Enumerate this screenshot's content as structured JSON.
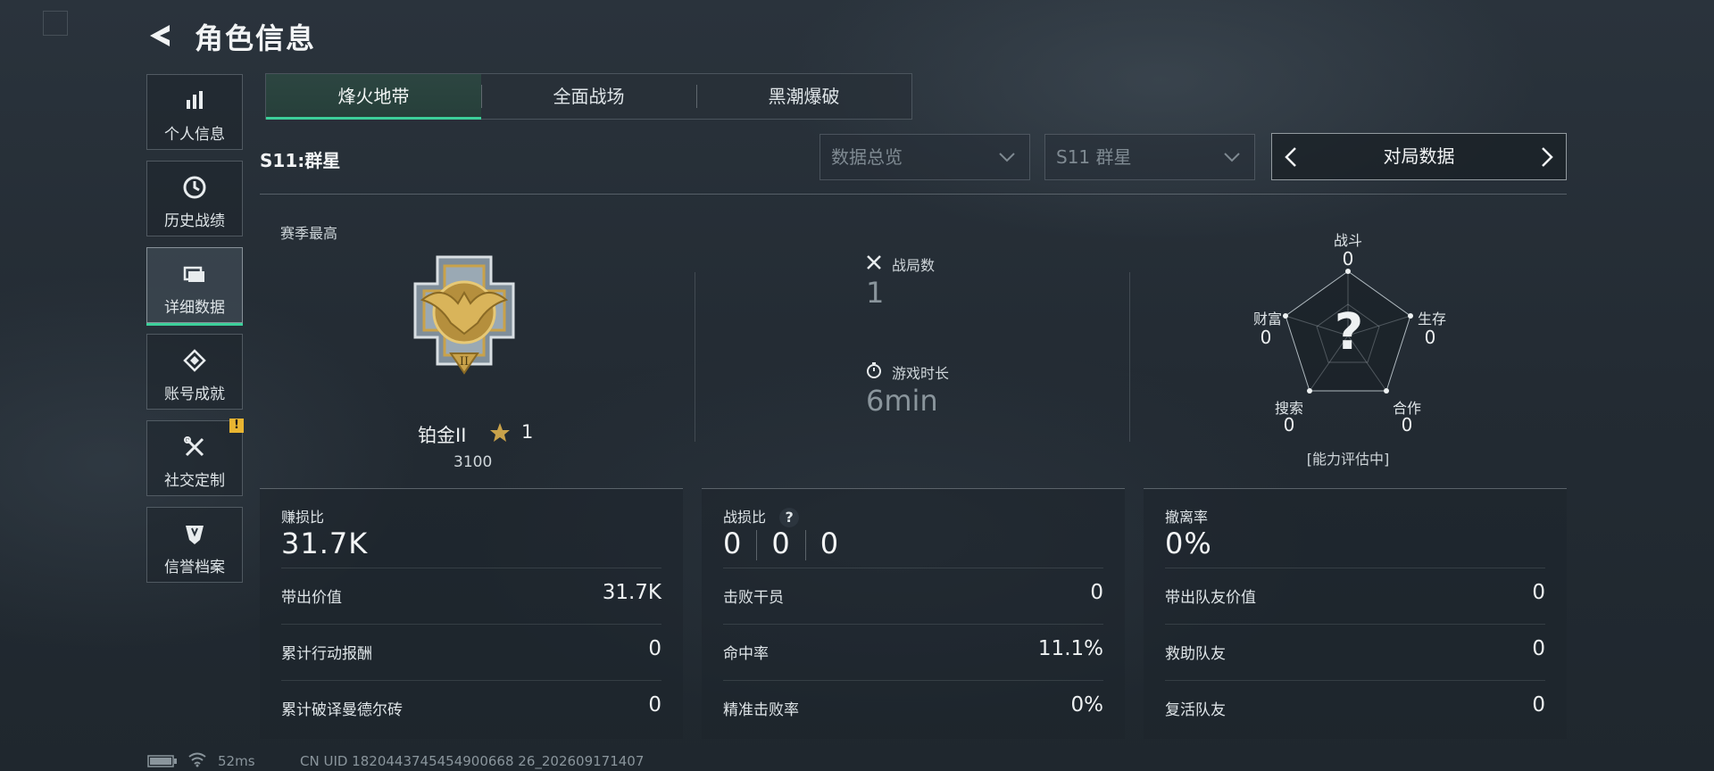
{
  "header": {
    "title": "角色信息"
  },
  "sidebar": {
    "items": [
      {
        "label": "个人信息",
        "icon": "bar-chart-icon"
      },
      {
        "label": "历史战绩",
        "icon": "clock-icon"
      },
      {
        "label": "详细数据",
        "icon": "folder-icon",
        "active": true
      },
      {
        "label": "账号成就",
        "icon": "achievement-icon"
      },
      {
        "label": "社交定制",
        "icon": "wrench-icon",
        "badge": "!"
      },
      {
        "label": "信誉档案",
        "icon": "shield-icon"
      }
    ]
  },
  "tabs": [
    {
      "label": "烽火地带",
      "active": true
    },
    {
      "label": "全面战场"
    },
    {
      "label": "黑潮爆破"
    }
  ],
  "season_label": "S11:群星",
  "filters": {
    "data_view": "数据总览",
    "season": "S11 群星",
    "match_data": "对局数据"
  },
  "rank": {
    "caption": "赛季最高",
    "tier": "铂金II",
    "stars": "1",
    "score": "3100",
    "emblem_numeral": "II"
  },
  "summary": {
    "matches_label": "战局数",
    "matches_value": "1",
    "playtime_label": "游戏时长",
    "playtime_value": "6min"
  },
  "radar": {
    "center": "?",
    "axes": [
      {
        "label": "战斗",
        "value": "0"
      },
      {
        "label": "生存",
        "value": "0"
      },
      {
        "label": "合作",
        "value": "0"
      },
      {
        "label": "搜索",
        "value": "0"
      },
      {
        "label": "财富",
        "value": "0"
      }
    ],
    "status": "[能力评估中]"
  },
  "cards": [
    {
      "title": "赚损比",
      "value": "31.7K",
      "rows": [
        {
          "label": "带出价值",
          "value": "31.7K"
        },
        {
          "label": "累计行动报酬",
          "value": "0"
        },
        {
          "label": "累计破译曼德尔砖",
          "value": "0"
        }
      ]
    },
    {
      "title": "战损比",
      "help": "?",
      "values": [
        "0",
        "0",
        "0"
      ],
      "rows": [
        {
          "label": "击败干员",
          "value": "0"
        },
        {
          "label": "命中率",
          "value": "11.1%"
        },
        {
          "label": "精准击败率",
          "value": "0%"
        }
      ]
    },
    {
      "title": "撤离率",
      "value": "0%",
      "rows": [
        {
          "label": "带出队友价值",
          "value": "0"
        },
        {
          "label": "救助队友",
          "value": "0"
        },
        {
          "label": "复活队友",
          "value": "0"
        }
      ]
    }
  ],
  "footer": {
    "ping": "52ms",
    "uid": "CN UID 1820443745454900668 26_202609171407"
  },
  "colors": {
    "accent": "#3ccf9a",
    "badge": "#e9b531",
    "gold": "#c9a24a"
  }
}
